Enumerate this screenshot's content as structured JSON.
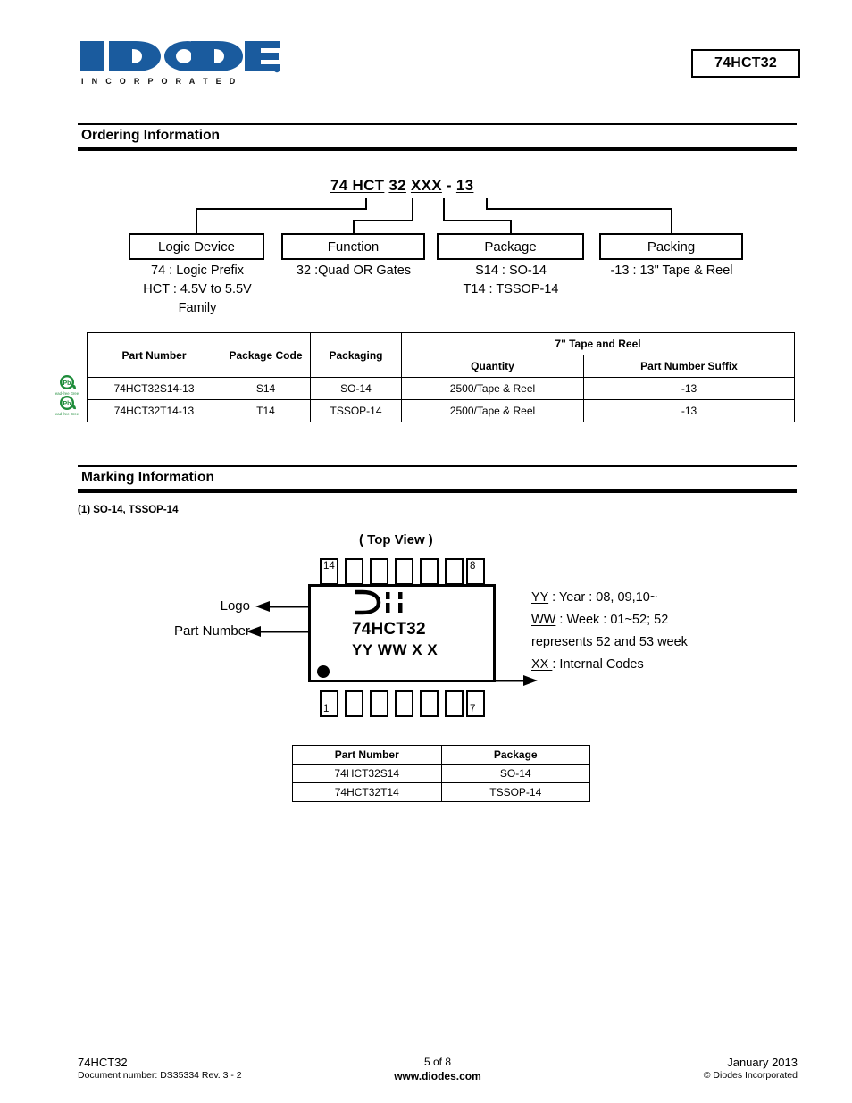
{
  "header": {
    "logo_text": "DIODES",
    "logo_subtext": "I N C O R P O R A T E D",
    "logo_color": "#1a5b9e",
    "part_number": "74HCT32"
  },
  "sections": {
    "ordering": "Ordering Information",
    "marking": "Marking Information"
  },
  "ordering_diagram": {
    "part_string": {
      "seg1": "74 HCT",
      "seg2": "32",
      "seg3": "XXX",
      "dash": "-",
      "seg4": "13"
    },
    "boxes": [
      {
        "label": "Logic Device",
        "desc": "74 : Logic Prefix\nHCT : 4.5V to 5.5V\nFamily"
      },
      {
        "label": "Function",
        "desc": "32 :Quad OR Gates"
      },
      {
        "label": "Package",
        "desc": "S14 : SO-14\nT14 : TSSOP-14"
      },
      {
        "label": "Packing",
        "desc": "-13 : 13\" Tape & Reel"
      }
    ]
  },
  "ordering_table": {
    "headers": {
      "part_number": "Part Number",
      "package_code": "Package Code",
      "packaging": "Packaging",
      "tape_reel": "7\" Tape and Reel",
      "quantity": "Quantity",
      "suffix": "Part Number Suffix"
    },
    "rows": [
      {
        "part_number": "74HCT32S14-13",
        "package_code": "S14",
        "packaging": "SO-14",
        "quantity": "2500/Tape & Reel",
        "suffix": "-13"
      },
      {
        "part_number": "74HCT32T14-13",
        "package_code": "T14",
        "packaging": "TSSOP-14",
        "quantity": "2500/Tape & Reel",
        "suffix": "-13"
      }
    ],
    "pbfree_icon_label": "Lead-free Green",
    "pbfree_icon_text": "Pb",
    "pbfree_color": "#1e8c3a"
  },
  "marking": {
    "note": "(1) SO-14, TSSOP-14",
    "top_view": "( Top View )",
    "pins": {
      "top_left": "14",
      "top_right": "8",
      "bottom_left": "1",
      "bottom_right": "7"
    },
    "package_part_number": "74HCT32",
    "package_code_line": {
      "yy": "YY",
      "ww": "WW",
      "x1": "X",
      "x2": "X"
    },
    "leaders": {
      "logo": "Logo",
      "part_number": "Part Number"
    },
    "legend": {
      "yy_key": "YY",
      "yy_text": " : Year : 08, 09,10~",
      "ww_key": "WW",
      "ww_text": " : Week : 01~52; 52",
      "ww_text2": "represents  52 and 53 week",
      "xx_key": "XX ",
      "xx_text": " :  Internal Codes"
    }
  },
  "marking_table": {
    "headers": {
      "part_number": "Part Number",
      "package": "Package"
    },
    "rows": [
      {
        "part_number": "74HCT32S14",
        "package": "SO-14"
      },
      {
        "part_number": "74HCT32T14",
        "package": "TSSOP-14"
      }
    ]
  },
  "footer": {
    "left_line1": "74HCT32",
    "left_line2": "Document number: DS35334  Rev. 3 - 2",
    "center_line1": "5 of 8",
    "center_line2": "www.diodes.com",
    "right_line1": "January 2013",
    "right_line2": "© Diodes Incorporated"
  }
}
